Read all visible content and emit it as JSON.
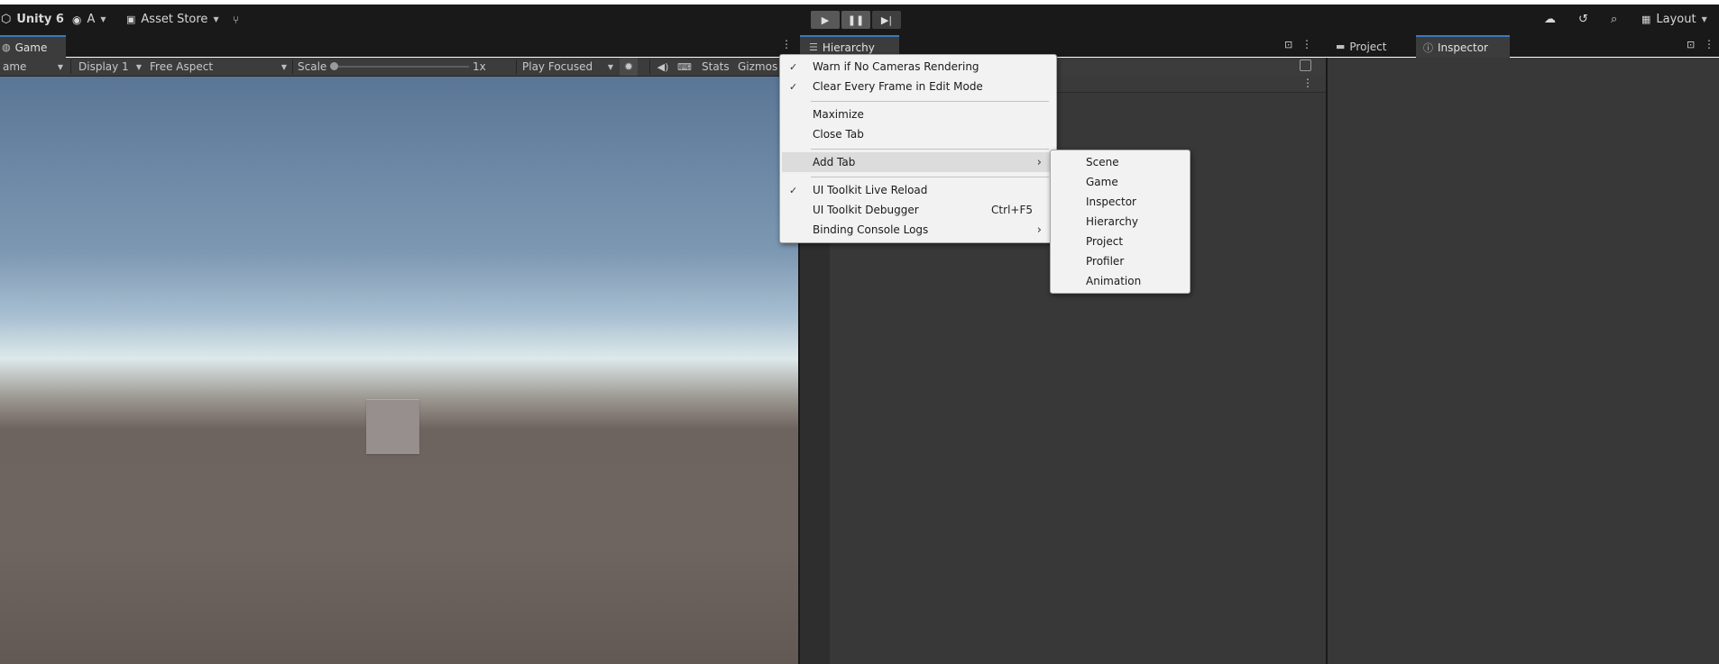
{
  "toolbar": {
    "app_title": "Unity 6",
    "account_label": "A",
    "asset_store_label": "Asset Store",
    "layout_label": "Layout"
  },
  "game_view": {
    "tab_label": "Game",
    "mode_dropdown": "ame",
    "display_dropdown": "Display 1",
    "aspect_dropdown": "Free Aspect",
    "scale_label": "Scale",
    "scale_value": "1x",
    "scale_level": 0.0,
    "play_mode_dropdown": "Play Focused",
    "stats_label": "Stats",
    "gizmos_label": "Gizmos"
  },
  "hierarchy": {
    "tab_label": "Hierarchy"
  },
  "right_panel": {
    "project_tab": "Project",
    "inspector_tab": "Inspector"
  },
  "context_menu": {
    "items": [
      {
        "label": "Warn if No Cameras Rendering",
        "checked": true
      },
      {
        "label": "Clear Every Frame in Edit Mode",
        "checked": true
      },
      {
        "label": "Maximize"
      },
      {
        "label": "Close Tab"
      },
      {
        "label": "Add Tab",
        "submenu": true,
        "highlighted": true
      },
      {
        "label": "UI Toolkit Live Reload",
        "checked": true
      },
      {
        "label": "UI Toolkit Debugger",
        "shortcut": "Ctrl+F5"
      },
      {
        "label": "Binding Console Logs",
        "submenu": true
      }
    ],
    "check_glyph": "✓",
    "arrow_glyph": "›"
  },
  "add_tab_submenu": {
    "items": [
      "Scene",
      "Game",
      "Inspector",
      "Hierarchy",
      "Project",
      "Profiler",
      "Animation"
    ]
  },
  "colors": {
    "accent_tab_blue": "#3a79bb",
    "menu_background": "#f2f2f2",
    "toolbar_background": "#191919"
  },
  "icons": {
    "unity_logo": "unity-logo-icon",
    "account": "account-icon",
    "asset_store": "bag-icon",
    "version_control": "branch-icon",
    "play": "play-icon",
    "pause": "pause-icon",
    "step": "step-icon",
    "cloud": "cloud-icon",
    "history": "history-icon",
    "search": "search-icon",
    "layout": "layout-icon"
  }
}
